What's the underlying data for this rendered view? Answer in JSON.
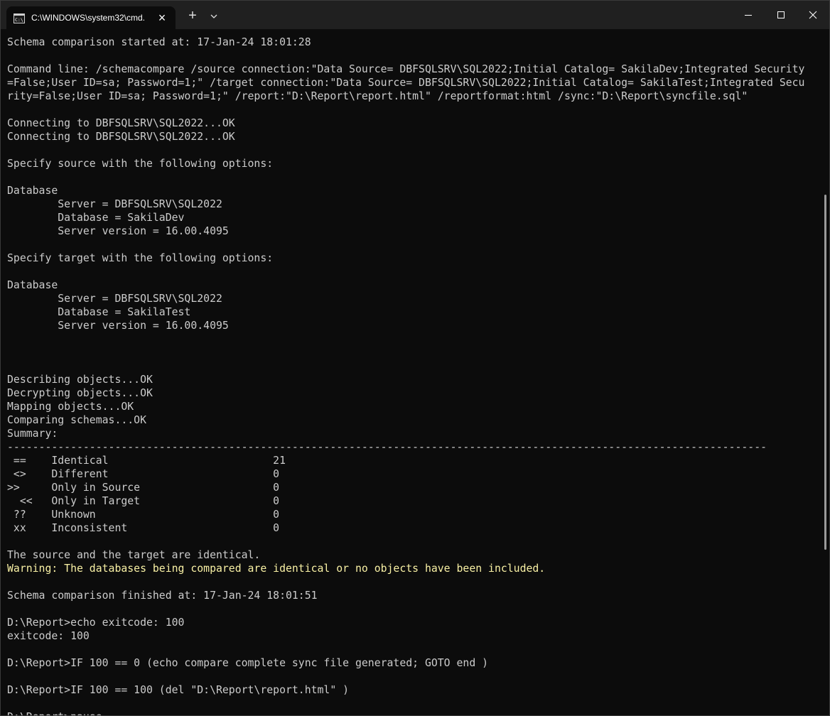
{
  "window": {
    "tab_title": "C:\\WINDOWS\\system32\\cmd.",
    "tab_icon": "cmd-icon",
    "new_tab_symbol": "+",
    "close_symbol": "×"
  },
  "terminal": {
    "lines": [
      "Schema comparison started at: 17-Jan-24 18:01:28",
      "",
      "Command line: /schemacompare /source connection:\"Data Source= DBFSQLSRV\\SQL2022;Initial Catalog= SakilaDev;Integrated Security",
      "=False;User ID=sa; Password=1;\" /target connection:\"Data Source= DBFSQLSRV\\SQL2022;Initial Catalog= SakilaTest;Integrated Secu",
      "rity=False;User ID=sa; Password=1;\" /report:\"D:\\Report\\report.html\" /reportformat:html /sync:\"D:\\Report\\syncfile.sql\"",
      "",
      "Connecting to DBFSQLSRV\\SQL2022...OK",
      "Connecting to DBFSQLSRV\\SQL2022...OK",
      "",
      "Specify source with the following options:",
      "",
      "Database",
      "        Server = DBFSQLSRV\\SQL2022",
      "        Database = SakilaDev",
      "        Server version = 16.00.4095",
      "",
      "Specify target with the following options:",
      "",
      "Database",
      "        Server = DBFSQLSRV\\SQL2022",
      "        Database = SakilaTest",
      "        Server version = 16.00.4095",
      "",
      "",
      "",
      "Describing objects...OK",
      "Decrypting objects...OK",
      "Mapping objects...OK",
      "Comparing schemas...OK",
      "Summary:",
      "------------------------------------------------------------------------------------------------------------------------",
      " ==    Identical                          21",
      " <>    Different                          0",
      ">>     Only in Source                     0",
      "  <<   Only in Target                     0",
      " ??    Unknown                            0",
      " xx    Inconsistent                       0",
      "",
      "The source and the target are identical.",
      "Warning: The databases being compared are identical or no objects have been included.",
      "",
      "Schema comparison finished at: 17-Jan-24 18:01:51",
      "",
      "D:\\Report>echo exitcode: 100",
      "exitcode: 100",
      "",
      "D:\\Report>IF 100 == 0 (echo compare complete sync file generated; GOTO end )",
      "",
      "D:\\Report>IF 100 == 100 (del \"D:\\Report\\report.html\" )",
      "",
      "D:\\Report>pause"
    ],
    "warning_line_index": 39,
    "text_color": "#cccccc",
    "warning_color": "#f9f1a5",
    "background": "#0c0c0c"
  }
}
